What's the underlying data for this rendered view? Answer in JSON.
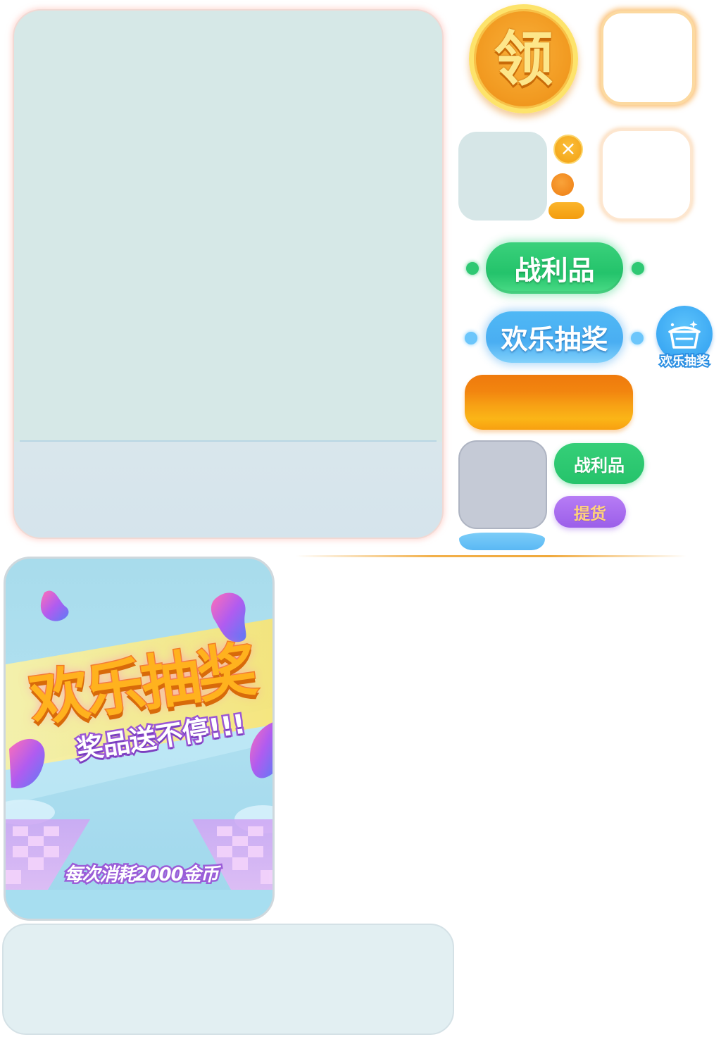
{
  "coin": {
    "label": "领"
  },
  "close_button": {
    "glyph": "×"
  },
  "banners": {
    "loot": "战利品",
    "lottery": "欢乐抽奖"
  },
  "lottery_icon": {
    "label": "欢乐抽奖",
    "icon": "basket-icon"
  },
  "small_buttons": {
    "loot": "战利品",
    "pickup": "提货"
  },
  "poster": {
    "title": "欢乐抽奖",
    "subtitle": "奖品送不停!!!",
    "cost_text": "每次消耗2000金币"
  },
  "colors": {
    "green": "#2fc873",
    "blue": "#4aaef2",
    "orange": "#f39d0f",
    "purple": "#9b5fe9",
    "gold_text": "#fde68a"
  }
}
